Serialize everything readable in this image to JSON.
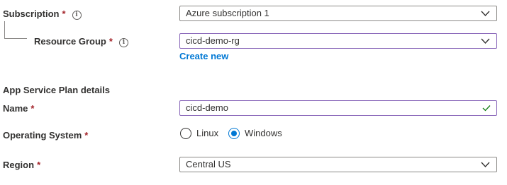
{
  "subscription": {
    "label": "Subscription",
    "required": "*",
    "info": "i",
    "value": "Azure subscription 1"
  },
  "resource_group": {
    "label": "Resource Group",
    "required": "*",
    "info": "i",
    "value": "cicd-demo-rg",
    "create_new": "Create new"
  },
  "app_service_plan": {
    "heading": "App Service Plan details",
    "name": {
      "label": "Name",
      "required": "*",
      "value": "cicd-demo"
    },
    "os": {
      "label": "Operating System",
      "required": "*",
      "options": [
        "Linux",
        "Windows"
      ],
      "selected": "Windows"
    },
    "region": {
      "label": "Region",
      "required": "*",
      "value": "Central US"
    }
  },
  "colors": {
    "accent": "#0078d4",
    "focus_border": "#8764b8",
    "valid_check": "#107c10",
    "required": "#a4262c"
  }
}
